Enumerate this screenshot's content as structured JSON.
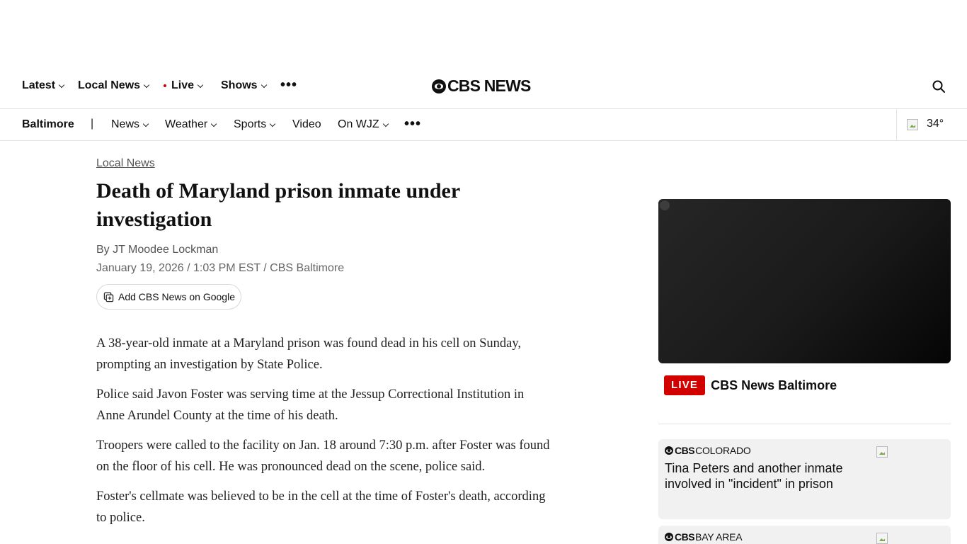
{
  "top_nav": {
    "latest": "Latest",
    "local_news": "Local News",
    "live": "Live",
    "shows": "Shows",
    "more": "•••",
    "logo_text": "CBS NEWS"
  },
  "local_nav": {
    "city": "Baltimore",
    "separator": "|",
    "news": "News",
    "weather": "Weather",
    "sports": "Sports",
    "video": "Video",
    "on_station": "On WJZ",
    "more": "•••",
    "temperature": "34°"
  },
  "article": {
    "kicker": "Local News",
    "headline": "Death of Maryland prison inmate under investigation",
    "byline": "By JT Moodee Lockman",
    "dateline": "January 19, 2026 / 1:03 PM EST / CBS Baltimore",
    "google_button": "Add CBS News on Google",
    "paragraphs": [
      "A 38-year-old inmate at a Maryland prison was found dead in his cell on Sunday, prompting an investigation by State Police.",
      "Police said Javon Foster was serving time at the Jessup Correctional Institution in Anne Arundel County at the time of his death.",
      "Troopers were called to the facility on Jan. 18 around 7:30 p.m. after Foster was found on the floor of his cell. He was pronounced dead on the scene, police said.",
      "Foster's cellmate was believed to be in the cell at the time of Foster's death, according to police."
    ]
  },
  "sidebar": {
    "live_badge": "LIVE",
    "live_title": "CBS News Baltimore",
    "cards": [
      {
        "brand_cbs": "CBS",
        "brand_region": "COLORADO",
        "title": "Tina Peters and another inmate involved in \"incident\" in prison"
      },
      {
        "brand_cbs": "CBS",
        "brand_region": "BAY AREA",
        "title": ""
      }
    ]
  },
  "colors": {
    "live_red": "#d30000",
    "card_bg": "#f1f1f1",
    "text": "#101010"
  },
  "icons": [
    "search-icon",
    "chevron-down-icon",
    "more-icon",
    "weather-icon",
    "google-add-icon",
    "cbs-eye-logo-icon"
  ]
}
